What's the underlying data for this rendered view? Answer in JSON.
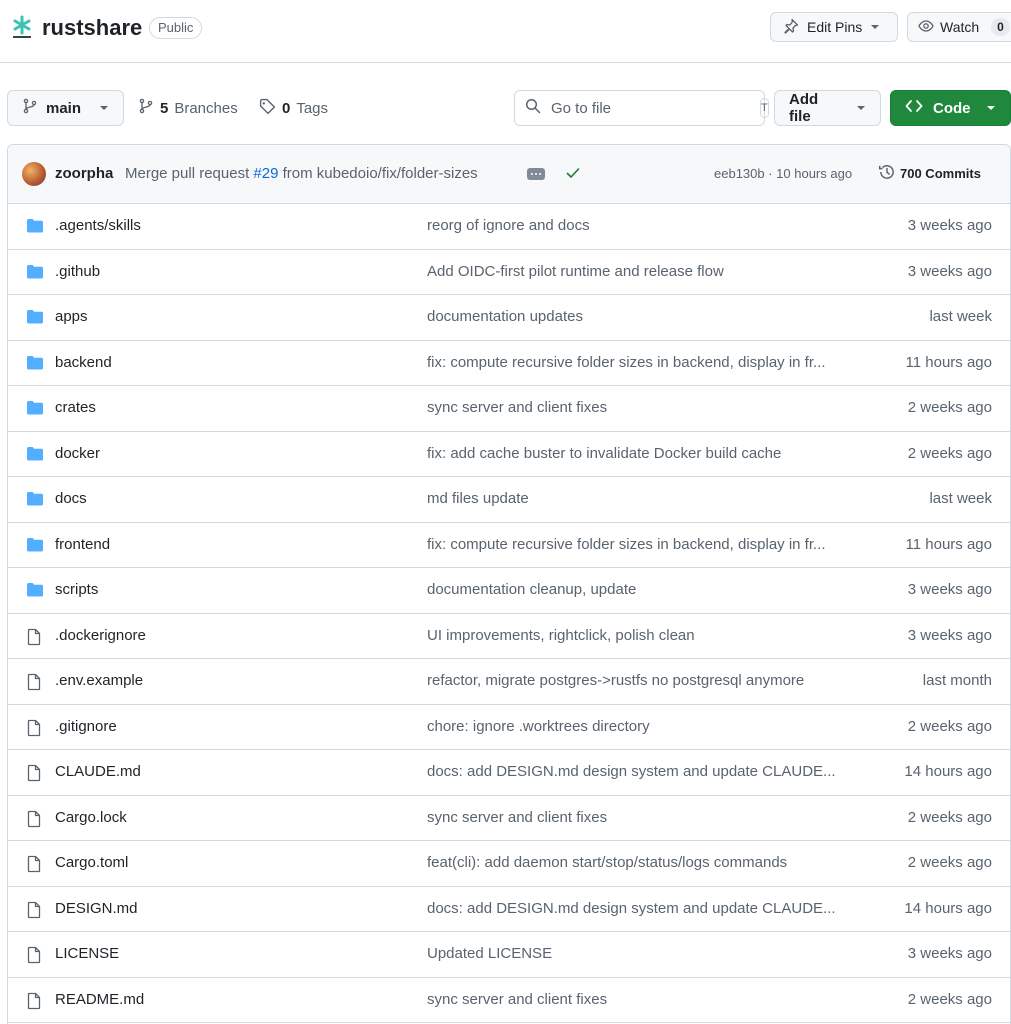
{
  "repo": {
    "name": "rustshare",
    "visibility": "Public"
  },
  "header_actions": {
    "edit_pins": "Edit Pins",
    "watch": "Watch",
    "watch_count": "0"
  },
  "toolbar": {
    "branch": "main",
    "branches_count": "5",
    "branches_label": "Branches",
    "tags_count": "0",
    "tags_label": "Tags",
    "search_placeholder": "Go to file",
    "search_shortcut": "T",
    "add_file": "Add file",
    "code": "Code"
  },
  "latest_commit": {
    "author": "zoorpha",
    "message_prefix": "Merge pull request ",
    "pr": "#29",
    "message_suffix": " from kubedoio/fix/folder-sizes",
    "sha_time": "eeb130b · 10 hours ago",
    "commits_count": "700 Commits"
  },
  "files": [
    {
      "type": "dir",
      "name": ".agents/skills",
      "message": "reorg of ignore and docs",
      "date": "3 weeks ago"
    },
    {
      "type": "dir",
      "name": ".github",
      "message": "Add OIDC-first pilot runtime and release flow",
      "date": "3 weeks ago"
    },
    {
      "type": "dir",
      "name": "apps",
      "message": "documentation updates",
      "date": "last week"
    },
    {
      "type": "dir",
      "name": "backend",
      "message": "fix: compute recursive folder sizes in backend, display in fr...",
      "date": "11 hours ago"
    },
    {
      "type": "dir",
      "name": "crates",
      "message": "sync server and client fixes",
      "date": "2 weeks ago"
    },
    {
      "type": "dir",
      "name": "docker",
      "message": "fix: add cache buster to invalidate Docker build cache",
      "date": "2 weeks ago"
    },
    {
      "type": "dir",
      "name": "docs",
      "message": "md files update",
      "date": "last week"
    },
    {
      "type": "dir",
      "name": "frontend",
      "message": "fix: compute recursive folder sizes in backend, display in fr...",
      "date": "11 hours ago"
    },
    {
      "type": "dir",
      "name": "scripts",
      "message": "documentation cleanup, update",
      "date": "3 weeks ago"
    },
    {
      "type": "file",
      "name": ".dockerignore",
      "message": "UI improvements, rightclick, polish clean",
      "date": "3 weeks ago"
    },
    {
      "type": "file",
      "name": ".env.example",
      "message": "refactor, migrate postgres->rustfs no postgresql anymore",
      "date": "last month"
    },
    {
      "type": "file",
      "name": ".gitignore",
      "message": "chore: ignore .worktrees directory",
      "date": "2 weeks ago"
    },
    {
      "type": "file",
      "name": "CLAUDE.md",
      "message": "docs: add DESIGN.md design system and update CLAUDE...",
      "date": "14 hours ago"
    },
    {
      "type": "file",
      "name": "Cargo.lock",
      "message": "sync server and client fixes",
      "date": "2 weeks ago"
    },
    {
      "type": "file",
      "name": "Cargo.toml",
      "message": "feat(cli): add daemon start/stop/status/logs commands",
      "date": "2 weeks ago"
    },
    {
      "type": "file",
      "name": "DESIGN.md",
      "message": "docs: add DESIGN.md design system and update CLAUDE...",
      "date": "14 hours ago"
    },
    {
      "type": "file",
      "name": "LICENSE",
      "message": "Updated LICENSE",
      "date": "3 weeks ago"
    },
    {
      "type": "file",
      "name": "README.md",
      "message": "sync server and client fixes",
      "date": "2 weeks ago"
    }
  ],
  "colors": {
    "folder": "#54aeff",
    "accent": "#0969da",
    "success": "#1a7f37",
    "code_button": "#1f883d"
  }
}
